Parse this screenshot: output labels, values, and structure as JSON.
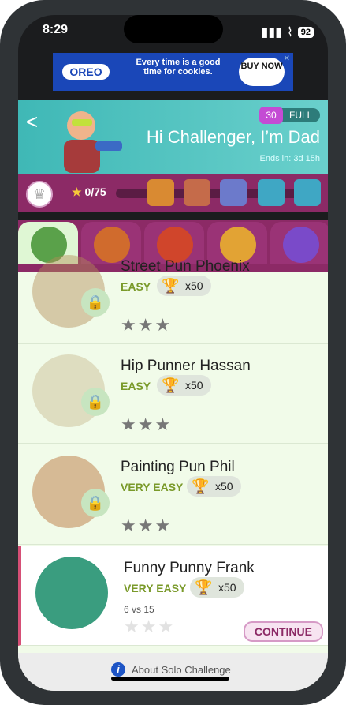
{
  "status": {
    "time": "8:29",
    "battery": "92"
  },
  "ad": {
    "brand": "OREO",
    "headline": "Every time is a good time for cookies.",
    "cta": "BUY NOW",
    "close": "✕",
    "adchoices": "▷"
  },
  "header": {
    "back_icon": "back-chevron-icon",
    "lives_count": "30",
    "lives_label": "FULL",
    "title": "Hi Challenger, I’m Dad",
    "ends": "Ends in: 3d 15h"
  },
  "progress": {
    "stars": "0/75",
    "chest_colors": [
      "#d98a32",
      "#c56b4a",
      "#6c7acb",
      "#3fa7c4",
      "#3fa7c4"
    ]
  },
  "tabs": {
    "portrait_colors": [
      "#5aa14a",
      "#d06b2d",
      "#d0452b",
      "#e2a334",
      "#7a4ac9"
    ]
  },
  "challengers": [
    {
      "name": "Street Pun Phoenix",
      "difficulty": "EASY",
      "reward": "x50",
      "stars": "★★★",
      "locked": true
    },
    {
      "name": "Hip Punner Hassan",
      "difficulty": "EASY",
      "reward": "x50",
      "stars": "★★★",
      "locked": true
    },
    {
      "name": "Painting Pun Phil",
      "difficulty": "VERY EASY",
      "reward": "x50",
      "stars": "★★★",
      "locked": true
    },
    {
      "name": "Funny Punny Frank",
      "difficulty": "VERY EASY",
      "reward": "x50",
      "stars": "★★★",
      "locked": false,
      "score": "6 vs 15",
      "cta": "CONTINUE"
    }
  ],
  "footer": {
    "about": "About Solo Challenge"
  }
}
